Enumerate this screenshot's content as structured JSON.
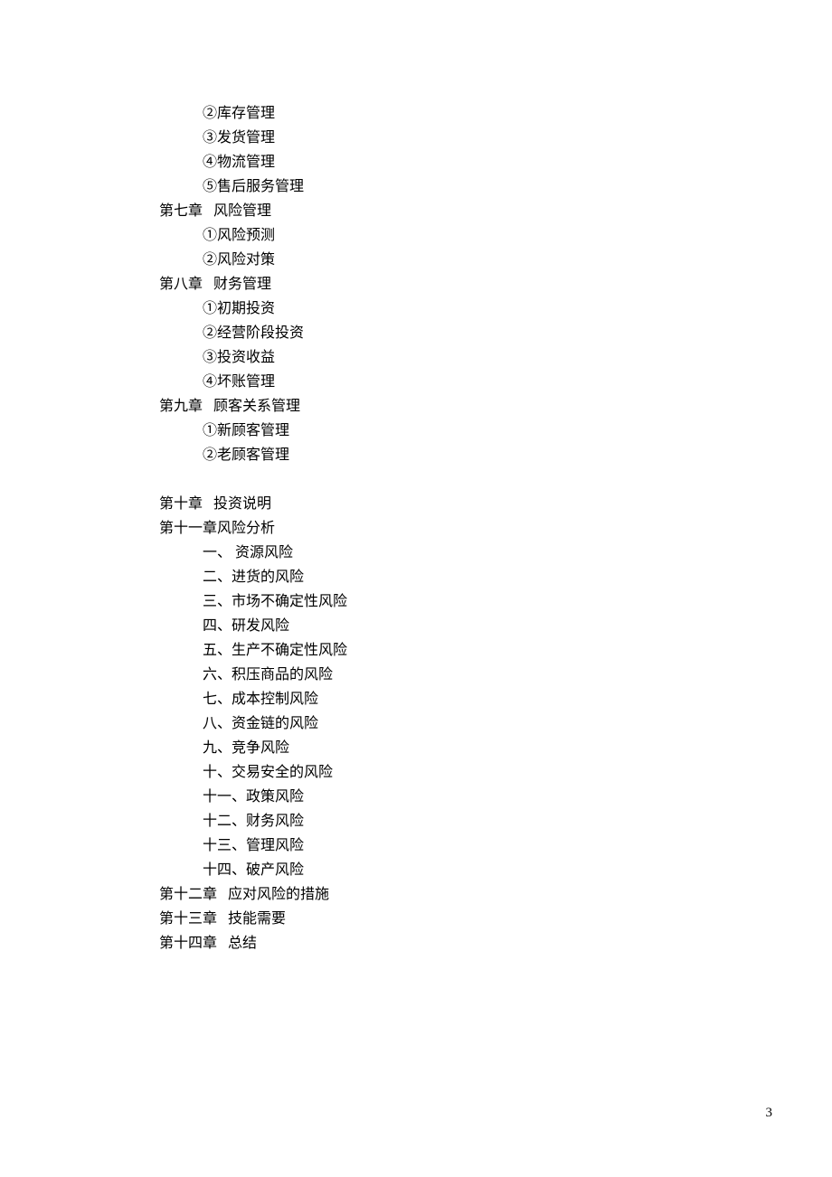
{
  "lines": {
    "l1": "②库存管理",
    "l2": "③发货管理",
    "l3": "④物流管理",
    "l4": "⑤售后服务管理",
    "l5": "第七章   风险管理",
    "l6": "①风险预测",
    "l7": "②风险对策",
    "l8": "第八章   财务管理",
    "l9": "①初期投资",
    "l10": "②经营阶段投资",
    "l11": "③投资收益",
    "l12": "④坏账管理",
    "l13": "第九章   顾客关系管理",
    "l14": "①新顾客管理",
    "l15": "②老顾客管理",
    "l16": "第十章   投资说明",
    "l17": "第十一章风险分析",
    "l18": "一、 资源风险",
    "l19": "二、进货的风险",
    "l20": "三、市场不确定性风险",
    "l21": "四、研发风险",
    "l22": "五、生产不确定性风险",
    "l23": "六、积压商品的风险",
    "l24": "七、成本控制风险",
    "l25": "八、资金链的风险",
    "l26": "九、竞争风险",
    "l27": "十、交易安全的风险",
    "l28": "十一、政策风险",
    "l29": "十二、财务风险",
    "l30": "十三、管理风险",
    "l31": "十四、破产风险",
    "l32": "第十二章   应对风险的措施",
    "l33": "第十三章   技能需要",
    "l34": "第十四章   总结"
  },
  "pageNumber": "3"
}
